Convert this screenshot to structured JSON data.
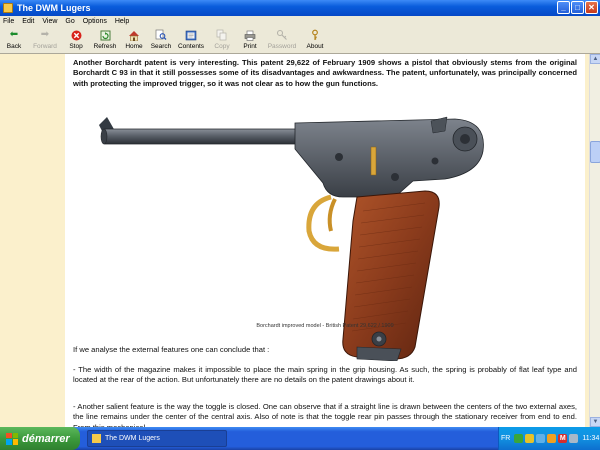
{
  "window": {
    "title": "The DWM Lugers"
  },
  "menu": {
    "items": [
      "File",
      "Edit",
      "View",
      "Go",
      "Options",
      "Help"
    ]
  },
  "toolbar": {
    "back": "Back",
    "forward": "Forward",
    "stop": "Stop",
    "refresh": "Refresh",
    "home": "Home",
    "search": "Search",
    "contents": "Contents",
    "copy": "Copy",
    "print": "Print",
    "password": "Password",
    "about": "About"
  },
  "content": {
    "intro": "Another Borchardt patent is very interesting. This patent 29,622 of February 1909 shows a pistol that obviously stems from the original Borchardt C 93 in that it still possesses some of its disadvantages and awkwardness. The patent, unfortunately, was principally concerned with protecting the improved trigger, so it was not clear as to how the gun functions.",
    "caption": "Borchardt improved model - British Patent 29,622 / 1909",
    "p2": "If we analyse the external features one can conclude that :",
    "p3": "- The width of the magazine makes it impossible to place the main spring in the grip housing. As such, the spring is probably of flat leaf type and located at the rear of the action. But unfortunately there are no details on the patent drawings about it.",
    "p4": "- Another salient feature is the way the toggle is closed. One can observe that if a straight line is drawn between the centers of the two external axes, the line remains under the center of the central axis. Also of note is that the toggle rear pin passes through the stationary receiver from end to end. From this mechanical"
  },
  "taskbar": {
    "start_label": "démarrer",
    "task_label": "The DWM Lugers",
    "lang": "FR",
    "clock": "11:34"
  },
  "colors": {
    "page_bg": "#fbf0cc",
    "wood": "#8a3b1c",
    "steel": "#5a6069",
    "gold": "#d9a63a"
  }
}
